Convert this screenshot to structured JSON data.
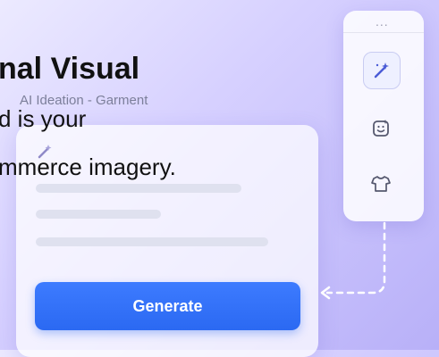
{
  "headline": "nal Visual",
  "subtitle_line1": "d is your",
  "subtitle_line2": "mmerce imagery.",
  "card": {
    "header": "AI Ideation - Garment",
    "generate_label": "Generate"
  },
  "toolbar": {
    "menu_dots": "...",
    "items": [
      {
        "icon": "magic-wand-icon",
        "active": true
      },
      {
        "icon": "sticker-icon",
        "active": false
      },
      {
        "icon": "shirt-icon",
        "active": false
      }
    ]
  },
  "colors": {
    "accent": "#2b69f2",
    "background": "#d6d0ff"
  }
}
